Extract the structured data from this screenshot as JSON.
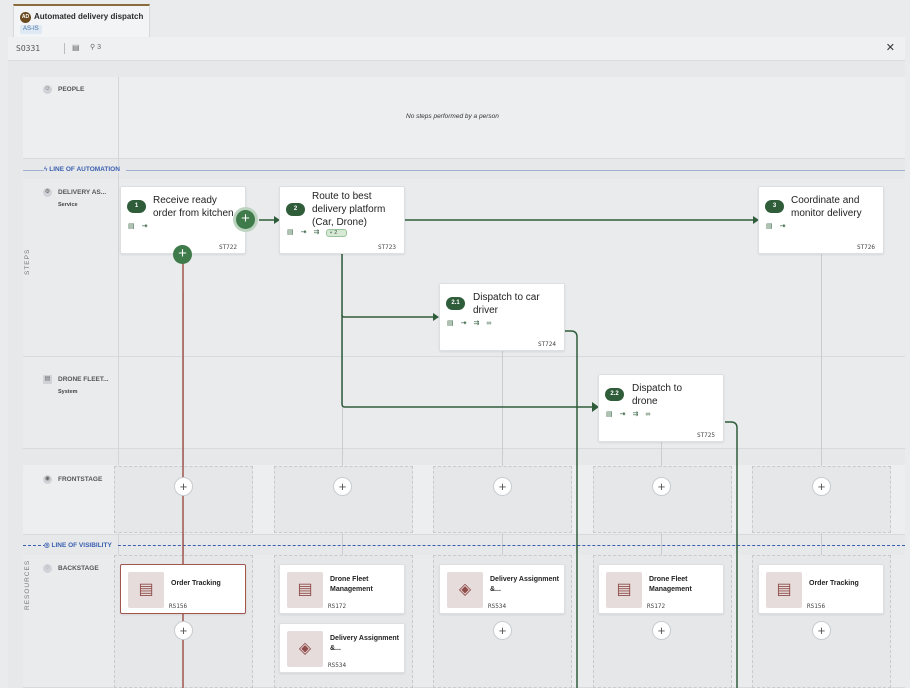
{
  "tab": {
    "avatar": "AD",
    "title": "Automated delivery dispatch",
    "badge": "AS-IS"
  },
  "header": {
    "id": "SO331",
    "comments": "3"
  },
  "lanes": {
    "people": {
      "name": "PEOPLE",
      "empty": "No steps performed by a person"
    },
    "automation_line": "LINE OF AUTOMATION",
    "delivery": {
      "name": "DELIVERY AS...",
      "sub": "Service"
    },
    "drone": {
      "name": "DRONE FLEET...",
      "sub": "System"
    },
    "frontstage": {
      "name": "FRONTSTAGE"
    },
    "visibility_line": "LINE OF VISIBILITY",
    "backstage": {
      "name": "BACKSTAGE"
    },
    "steps_label": "STEPS",
    "resources_label": "RESOURCES"
  },
  "steps": [
    {
      "num": "1",
      "title": "Receive ready order from kitchen",
      "id": "ST722"
    },
    {
      "num": "2",
      "title": "Route to best delivery platform (Car, Drone)",
      "id": "ST723",
      "pill": "2"
    },
    {
      "num": "3",
      "title": "Coordinate and monitor delivery",
      "id": "ST726"
    },
    {
      "num": "2.1",
      "title": "Dispatch to car driver",
      "id": "ST724"
    },
    {
      "num": "2.2",
      "title": "Dispatch to drone",
      "id": "ST725"
    }
  ],
  "resources": [
    {
      "title": "Order Tracking",
      "id": "RS156"
    },
    {
      "title": "Drone Fleet Management",
      "id": "RS172"
    },
    {
      "title": "Delivery Assignment &...",
      "id": "RS534"
    },
    {
      "title": "Delivery Assignment &...",
      "id": "RS534"
    },
    {
      "title": "Drone Fleet Management",
      "id": "RS172"
    },
    {
      "title": "Order Tracking",
      "id": "RS156"
    }
  ],
  "colors": {
    "accent_green": "#2f5d3a",
    "automation_blue": "#3b5fb0",
    "resource_red": "#a0564f"
  }
}
